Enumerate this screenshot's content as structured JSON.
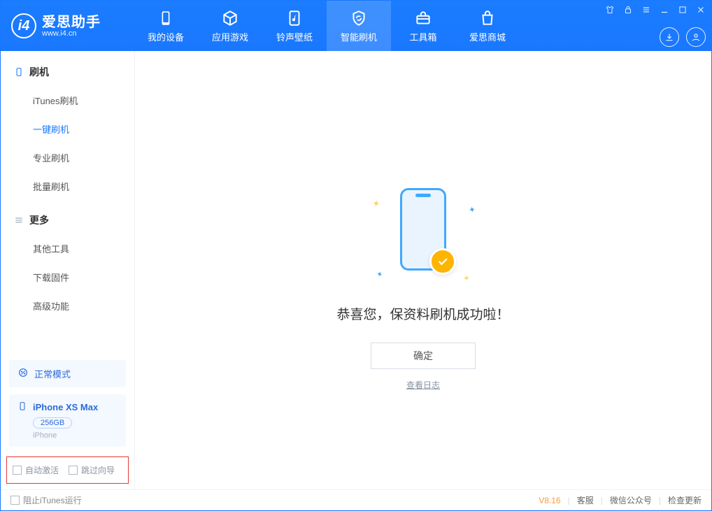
{
  "brand": {
    "name": "爱思助手",
    "url": "www.i4.cn"
  },
  "nav": {
    "items": [
      {
        "label": "我的设备"
      },
      {
        "label": "应用游戏"
      },
      {
        "label": "铃声壁纸"
      },
      {
        "label": "智能刷机"
      },
      {
        "label": "工具箱"
      },
      {
        "label": "爱思商城"
      }
    ]
  },
  "sidebar": {
    "group1_title": "刷机",
    "group1_items": [
      "iTunes刷机",
      "一键刷机",
      "专业刷机",
      "批量刷机"
    ],
    "group2_title": "更多",
    "group2_items": [
      "其他工具",
      "下载固件",
      "高级功能"
    ],
    "mode_label": "正常模式",
    "device": {
      "name": "iPhone XS Max",
      "capacity": "256GB",
      "type": "iPhone"
    },
    "opts": {
      "auto_activate": "自动激活",
      "skip_guide": "跳过向导"
    }
  },
  "main": {
    "success_text": "恭喜您，保资料刷机成功啦！",
    "ok_label": "确定",
    "log_link": "查看日志"
  },
  "statusbar": {
    "block_itunes": "阻止iTunes运行",
    "version": "V8.16",
    "links": [
      "客服",
      "微信公众号",
      "检查更新"
    ]
  }
}
